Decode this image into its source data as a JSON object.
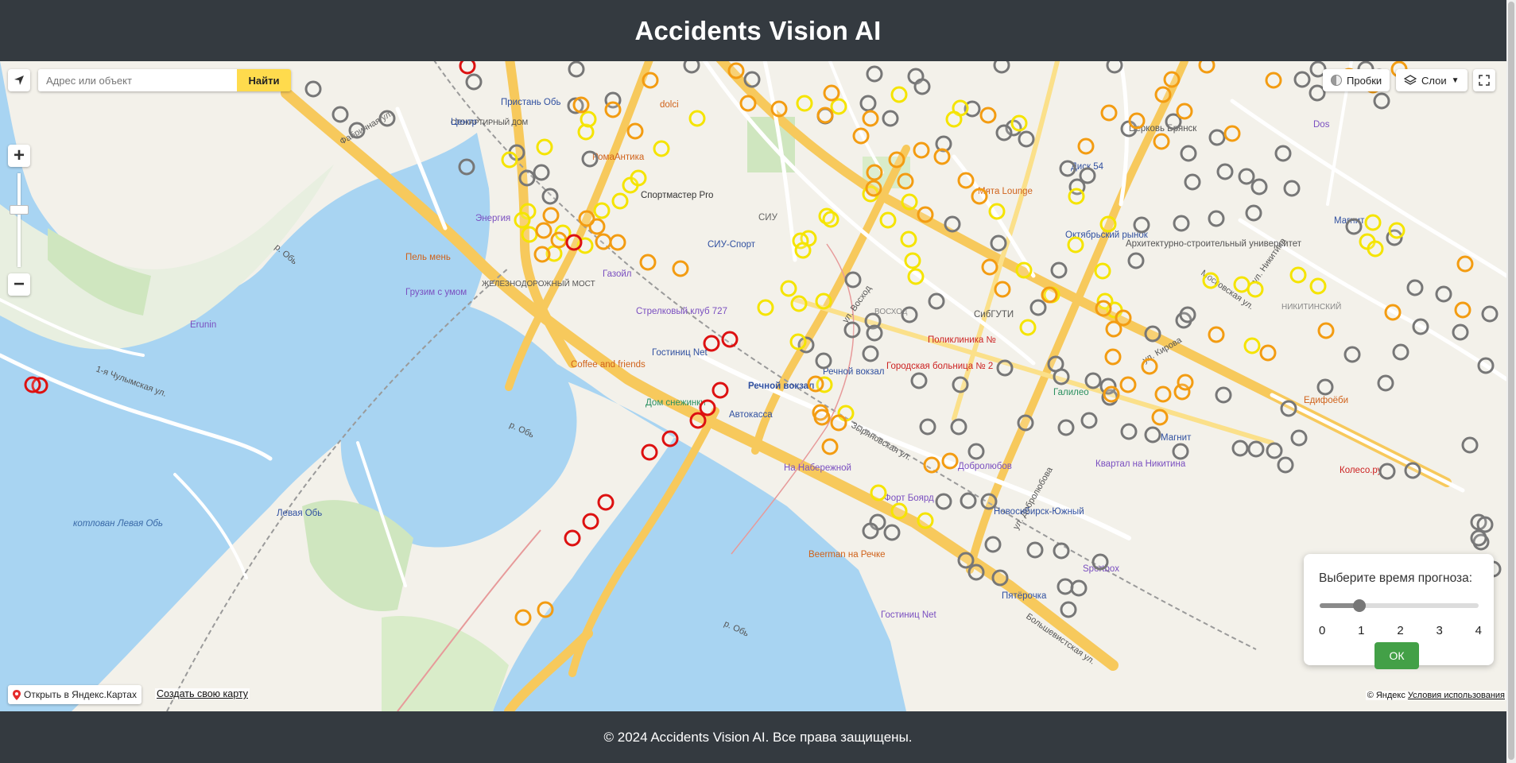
{
  "header": {
    "title": "Accidents Vision AI"
  },
  "footer": {
    "text": "© 2024 Accidents Vision AI. Все права защищены."
  },
  "search": {
    "placeholder": "Адрес или объект",
    "button": "Найти"
  },
  "controls": {
    "traffic": "Пробки",
    "layers": "Слои"
  },
  "zoom": {
    "plus": "+",
    "minus": "−"
  },
  "bottom": {
    "open_yandex": "Открыть в Яндекс.Картах",
    "create_map": "Создать свою карту",
    "copyright": "© Яндекс",
    "terms": "Условия использования"
  },
  "forecast": {
    "title": "Выберите время прогноза:",
    "ticks": [
      "0",
      "1",
      "2",
      "3",
      "4"
    ],
    "value": 1,
    "min": 0,
    "max": 4,
    "ok": "ОК"
  },
  "map_labels": {
    "center": "Центр",
    "energia": "Энергия",
    "pel": "Пель мень",
    "gruzim": "Грузим с умом",
    "erunin": "Erunin",
    "romaantika": "РомаАнтика",
    "sportmaster": "Спортмастер Pro",
    "siu": "СИУ",
    "siusport": "СИУ-Спорт",
    "gazoil": "Газойл",
    "bridge": "ЖЕЛЕЗНОДОРОЖНЫЙ МОСТ",
    "strelkovy": "Стрелковый клуб 727",
    "gostinica": "Гостиниц Net",
    "coffee": "Coffee and friends",
    "snezhinki": "Дом снежинки",
    "rechnoy": "Речной вокзал",
    "rechnoy2": "Речной вокзал",
    "avtokassa": "Автокасса",
    "naberezh": "На Набережной",
    "fort": "Форт Боярд",
    "levaya": "Левая Обь",
    "kotlovan": "котлован Левая Обь",
    "beerman": "Beerman на Речке",
    "novosib": "Новосибирск-Южный",
    "dobrolubov": "Добролюбов",
    "galileo": "Галилео",
    "kvartal": "Квартал на Никитина",
    "magnit": "Магнит",
    "magnit2": "Магнит",
    "edifood": "Едифоёби",
    "koleso": "Колесо.ру",
    "sportbox": "Sportbox",
    "pyaterochka": "Пятёрочка",
    "gostinica2": "Гостиниц Net",
    "poliklinika": "Поликлиника №",
    "bolnica": "Городская больница № 2",
    "sibguti": "СибГУТИ",
    "voshod": "ВОСХОД",
    "myata": "Мята Lounge",
    "disk": "Диск 54",
    "arch": "Архитектурно-строительный университет",
    "nikitinsky": "НИКИТИНСКИЙ",
    "oktyabr": "Октябрьский рынок",
    "tserkov": "Церковь Брянск",
    "dos": "Dos",
    "ob1": "р. Обь",
    "ob2": "р. Обь",
    "ob3": "р. Обь",
    "dolci": "dolci",
    "pristan": "Пристань Обь",
    "stokart": "СТОКАРТИРНЫЙ ДОМ",
    "str_farforovaya": "Фабричная ул.",
    "str_moskovskaya": "Московская ул.",
    "str_kirova": "ул. Кирова",
    "str_voskhod": "ул. Восход",
    "str_bolshevistskaya": "Большевистская ул.",
    "str_nikitina": "ул. Никитина",
    "str_zyryanovskaya": "Зыряновская ул.",
    "str_dobrolubova": "ул. Добролюбова",
    "str_chulymskaya": "1-я Чулымская ул."
  },
  "legend_colors": {
    "gray": "#777777",
    "yellow": "#f5e400",
    "orange": "#f39c12",
    "red": "#dd1111"
  }
}
